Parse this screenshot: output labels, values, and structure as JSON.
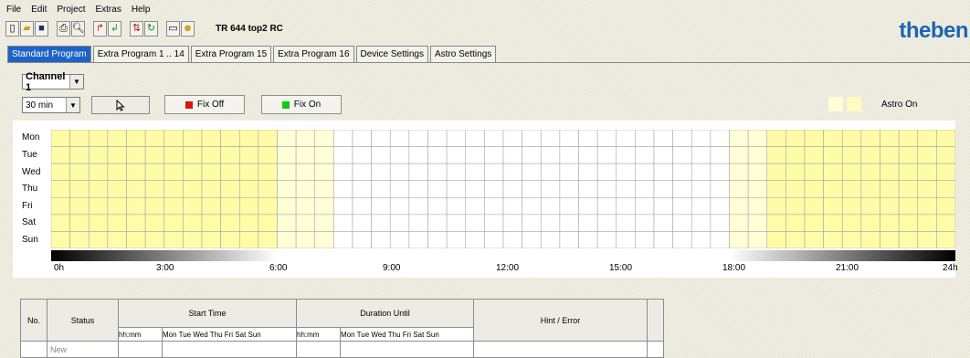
{
  "menu": [
    "File",
    "Edit",
    "Project",
    "Extras",
    "Help"
  ],
  "toolbar": {
    "buttons": [
      "new-file-icon",
      "open-folder-icon",
      "save-icon",
      "print-icon",
      "print-preview-icon",
      "upload-icon",
      "download-icon",
      "sort-icon",
      "refresh-icon",
      "device-window-icon",
      "wizard-icon"
    ],
    "device_title": "TR 644 top2 RC"
  },
  "logo_text": "theben",
  "tabs": [
    "Standard Program",
    "Extra Program 1 .. 14",
    "Extra Program 15",
    "Extra Program 16",
    "Device Settings",
    "Astro Settings"
  ],
  "channel": {
    "selected": "Channel 1"
  },
  "interval": {
    "selected": "30 min"
  },
  "buttons": {
    "fix_off": "Fix Off",
    "fix_on": "Fix On"
  },
  "astro": {
    "label": "Astro On"
  },
  "schedule": {
    "days": [
      "Mon",
      "Tue",
      "Wed",
      "Thu",
      "Fri",
      "Sat",
      "Sun"
    ],
    "slots_per_day": 48,
    "astro_on_slots": "0-11 and 38-47 filled; 12-14 and 36-37 light",
    "time_labels": [
      "0h",
      "3:00",
      "6:00",
      "9:00",
      "12:00",
      "15:00",
      "18:00",
      "21:00",
      "24h"
    ]
  },
  "colors": {
    "astro_fill": "#fffca8",
    "astro_light": "#fffed6",
    "fix_off": "#e01010",
    "fix_on": "#11c811",
    "tab_active": "#1e63c6",
    "logo": "#1f64b4"
  },
  "table": {
    "headers": {
      "no": "No.",
      "status": "Status",
      "start_time": "Start Time",
      "duration_until": "Duration Until",
      "hint": "Hint / Error"
    },
    "sub_headers": {
      "hhmm_start": "hh:mm",
      "days_start": "Mon Tue Wed Thu  Fri  Sat  Sun",
      "hhmm_dur": "hh:mm",
      "days_dur": "Mon Tue Wed Thu  Fri  Sat  Sun"
    },
    "new_row": {
      "status": "New"
    }
  }
}
